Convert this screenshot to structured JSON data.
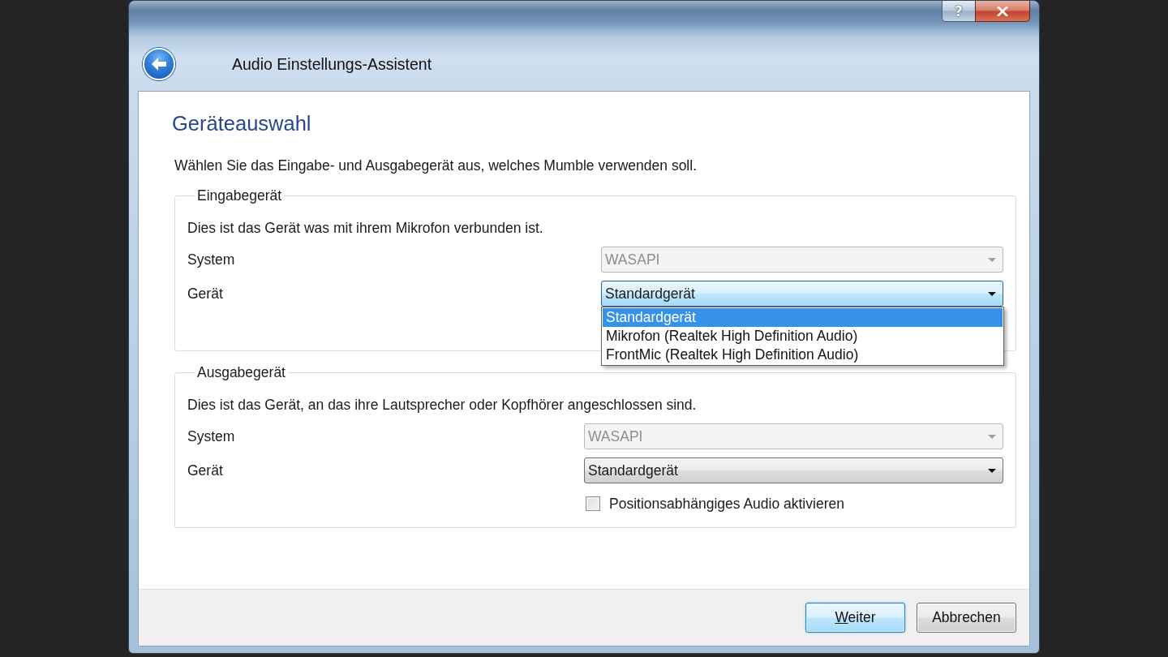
{
  "window": {
    "title": "Audio Einstellungs-Assistent",
    "help_button": "?"
  },
  "page": {
    "heading": "Geräteauswahl",
    "intro": "Wählen Sie das Eingabe- und Ausgabegerät aus, welches Mumble verwenden soll."
  },
  "groups": [
    {
      "title": "Eingabegerät",
      "description": "Dies ist das Gerät was mit ihrem Mikrofon verbunden ist.",
      "fields": [
        {
          "label": "System",
          "value": "WASAPI",
          "disabled": true,
          "expanded": false
        },
        {
          "label": "Gerät",
          "value": "Standardgerät",
          "disabled": false,
          "expanded": true,
          "options": [
            {
              "label": "Standardgerät",
              "selected": true
            },
            {
              "label": "Mikrofon (Realtek High Definition Audio)",
              "selected": false
            },
            {
              "label": "FrontMic (Realtek High Definition Audio)",
              "selected": false
            }
          ]
        }
      ]
    },
    {
      "title": "Ausgabegerät",
      "description": "Dies ist das Gerät, an das ihre Lautsprecher oder Kopfhörer angeschlossen sind.",
      "fields": [
        {
          "label": "System",
          "value": "WASAPI",
          "disabled": true,
          "expanded": false
        },
        {
          "label": "Gerät",
          "value": "Standardgerät",
          "disabled": false,
          "expanded": false
        }
      ],
      "checkbox": {
        "label": "Positionsabhängiges Audio aktivieren",
        "checked": false
      }
    }
  ],
  "buttons": [
    {
      "label": "Weiter",
      "default": true,
      "mnemonic": true
    },
    {
      "label": "Abbrechen",
      "default": false,
      "mnemonic": false
    }
  ]
}
